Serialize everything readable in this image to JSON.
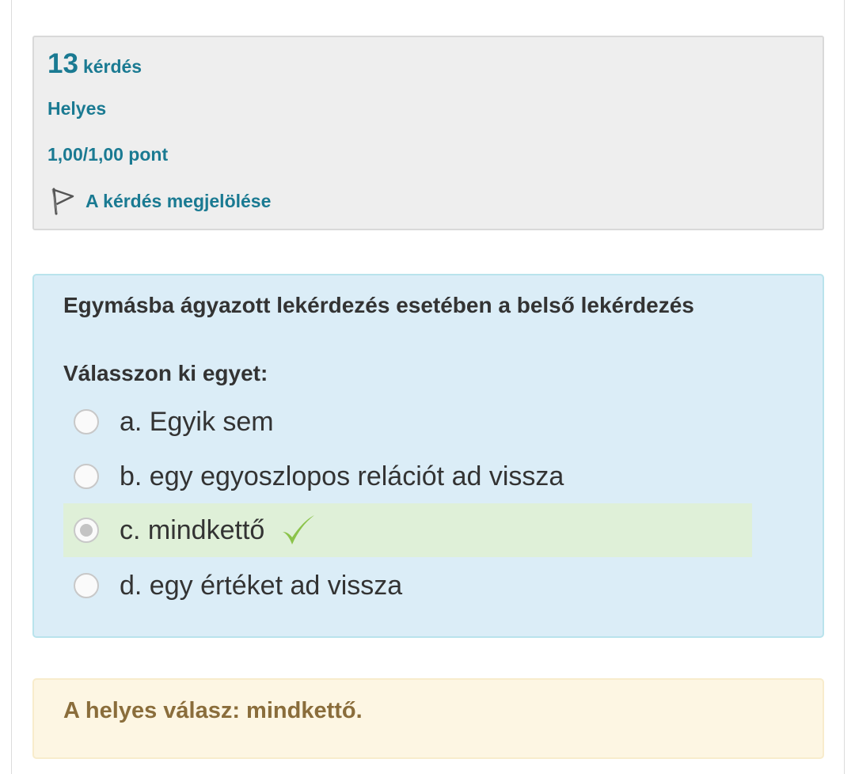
{
  "question_info": {
    "number": "13",
    "label": "kérdés",
    "state": "Helyes",
    "grade": "1,00/1,00 pont",
    "flag_label": "A kérdés megjelölése",
    "flag_icon": "flag-icon"
  },
  "question": {
    "text": "Egymásba ágyazott lekérdezés esetében a belső lekérdezés",
    "prompt": "Válasszon ki egyet:",
    "answers": [
      {
        "label": "a. Egyik sem",
        "selected": false,
        "correct": false
      },
      {
        "label": "b. egy egyoszlopos relációt ad vissza",
        "selected": false,
        "correct": false
      },
      {
        "label": "c. mindkettő",
        "selected": true,
        "correct": true
      },
      {
        "label": "d. egy értéket ad vissza",
        "selected": false,
        "correct": false
      }
    ],
    "correct_icon": "check-icon"
  },
  "feedback": {
    "right_answer": "A helyes válasz: mindkettő."
  },
  "colors": {
    "info_bg": "#eeeeee",
    "info_text": "#1a7a92",
    "content_bg": "#dbedf7",
    "correct_row_bg": "#dff0d8",
    "check_green": "#8bc34a",
    "feedback_bg": "#fdf6e3",
    "feedback_text": "#8a6d3b"
  }
}
